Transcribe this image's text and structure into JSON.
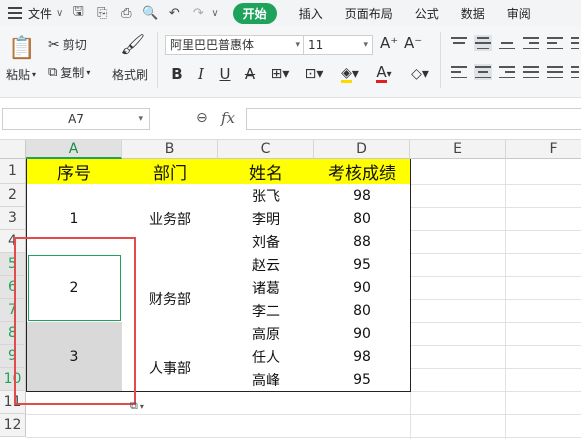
{
  "menu": {
    "file_label": "文件",
    "tabs": [
      "开始",
      "插入",
      "页面布局",
      "公式",
      "数据",
      "审阅"
    ]
  },
  "ribbon": {
    "paste_label": "粘贴",
    "cut_label": "剪切",
    "copy_label": "复制",
    "format_painter_label": "格式刷",
    "font_name": "阿里巴巴普惠体",
    "font_size": "11",
    "font_color": "#e02020",
    "fill_color": "#ffd800"
  },
  "formula_bar": {
    "name_box": "A7",
    "fx_label": "fx",
    "content": ""
  },
  "sheet": {
    "columns": [
      "A",
      "B",
      "C",
      "D",
      "E",
      "F"
    ],
    "rows": [
      "1",
      "2",
      "3",
      "4",
      "5",
      "6",
      "7",
      "8",
      "9",
      "10",
      "11",
      "12"
    ],
    "headers": [
      "序号",
      "部门",
      "姓名",
      "考核成绩"
    ],
    "seq": [
      "1",
      "2",
      "3"
    ],
    "departments": [
      "业务部",
      "财务部",
      "人事部"
    ],
    "names": [
      "张飞",
      "李明",
      "刘备",
      "赵云",
      "诸葛",
      "李二",
      "高原",
      "任人",
      "高峰"
    ],
    "scores": [
      "98",
      "80",
      "88",
      "95",
      "90",
      "80",
      "90",
      "98",
      "95"
    ],
    "header_fill": "#ffff00",
    "selected_fill": "#d9d9d9",
    "highlight_color": "#e04b4b"
  }
}
